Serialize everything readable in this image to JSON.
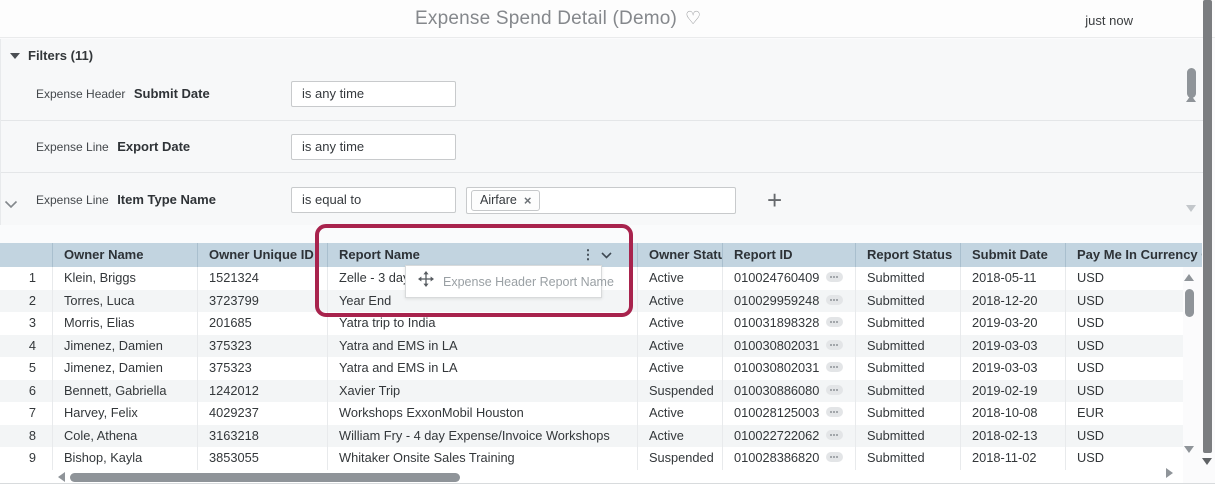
{
  "app": {
    "title": "Expense Spend Detail (Demo)",
    "updated": "just now"
  },
  "icons": {
    "favorite": "♡",
    "column_menu": "⋮",
    "remove_value": "×",
    "add_filter": "+"
  },
  "filters": {
    "header": "Filters (11)",
    "rows": [
      {
        "context": "Expense Header",
        "field": "Submit Date",
        "operator": "is any time"
      },
      {
        "context": "Expense Line",
        "field": "Export Date",
        "operator": "is any time"
      },
      {
        "context": "Expense Line",
        "field": "Item Type Name",
        "operator": "is equal to",
        "value": "Airfare"
      }
    ]
  },
  "drag_tooltip": {
    "label": "Expense Header Report Name"
  },
  "table": {
    "columns": [
      {
        "key": "num",
        "label": ""
      },
      {
        "key": "owner_name",
        "label": "Owner Name"
      },
      {
        "key": "owner_unique_id",
        "label": "Owner Unique ID"
      },
      {
        "key": "report_name",
        "label": "Report Name",
        "has_menu": true
      },
      {
        "key": "owner_status",
        "label": "Owner Status"
      },
      {
        "key": "report_id",
        "label": "Report ID",
        "has_related_actions": true
      },
      {
        "key": "report_status",
        "label": "Report Status"
      },
      {
        "key": "submit_date",
        "label": "Submit Date"
      },
      {
        "key": "currency",
        "label": "Pay Me In Currency C"
      }
    ],
    "rows": [
      {
        "num": "1",
        "owner_name": "Klein, Briggs",
        "owner_unique_id": "1521324",
        "report_name": "Zelle - 3 day",
        "owner_status": "Active",
        "report_id": "010024760409",
        "report_status": "Submitted",
        "submit_date": "2018-05-11",
        "currency": "USD"
      },
      {
        "num": "2",
        "owner_name": "Torres, Luca",
        "owner_unique_id": "3723799",
        "report_name": "Year End",
        "owner_status": "Active",
        "report_id": "010029959248",
        "report_status": "Submitted",
        "submit_date": "2018-12-20",
        "currency": "USD"
      },
      {
        "num": "3",
        "owner_name": "Morris, Elias",
        "owner_unique_id": "201685",
        "report_name": "Yatra trip to India",
        "owner_status": "Active",
        "report_id": "010031898328",
        "report_status": "Submitted",
        "submit_date": "2019-03-20",
        "currency": "USD"
      },
      {
        "num": "4",
        "owner_name": "Jimenez, Damien",
        "owner_unique_id": "375323",
        "report_name": "Yatra and EMS in LA",
        "owner_status": "Active",
        "report_id": "010030802031",
        "report_status": "Submitted",
        "submit_date": "2019-03-03",
        "currency": "USD"
      },
      {
        "num": "5",
        "owner_name": "Jimenez, Damien",
        "owner_unique_id": "375323",
        "report_name": "Yatra and EMS in LA",
        "owner_status": "Active",
        "report_id": "010030802031",
        "report_status": "Submitted",
        "submit_date": "2019-03-03",
        "currency": "USD"
      },
      {
        "num": "6",
        "owner_name": "Bennett, Gabriella",
        "owner_unique_id": "1242012",
        "report_name": "Xavier Trip",
        "owner_status": "Suspended",
        "report_id": "010030886080",
        "report_status": "Submitted",
        "submit_date": "2019-02-19",
        "currency": "USD"
      },
      {
        "num": "7",
        "owner_name": "Harvey, Felix",
        "owner_unique_id": "4029237",
        "report_name": "Workshops ExxonMobil Houston",
        "owner_status": "Active",
        "report_id": "010028125003",
        "report_status": "Submitted",
        "submit_date": "2018-10-08",
        "currency": "EUR"
      },
      {
        "num": "8",
        "owner_name": "Cole, Athena",
        "owner_unique_id": "3163218",
        "report_name": "William Fry - 4 day Expense/Invoice Workshops",
        "owner_status": "Active",
        "report_id": "010022722062",
        "report_status": "Submitted",
        "submit_date": "2018-02-13",
        "currency": "USD"
      },
      {
        "num": "9",
        "owner_name": "Bishop, Kayla",
        "owner_unique_id": "3853055",
        "report_name": "Whitaker Onsite Sales Training",
        "owner_status": "Suspended",
        "report_id": "010028386820",
        "report_status": "Submitted",
        "submit_date": "2018-11-02",
        "currency": "USD"
      }
    ]
  },
  "colors": {
    "grid_header_bg": "#c2d4e0",
    "annotation_red": "#a8234d",
    "zebra_row_bg": "#f3f5f6"
  }
}
